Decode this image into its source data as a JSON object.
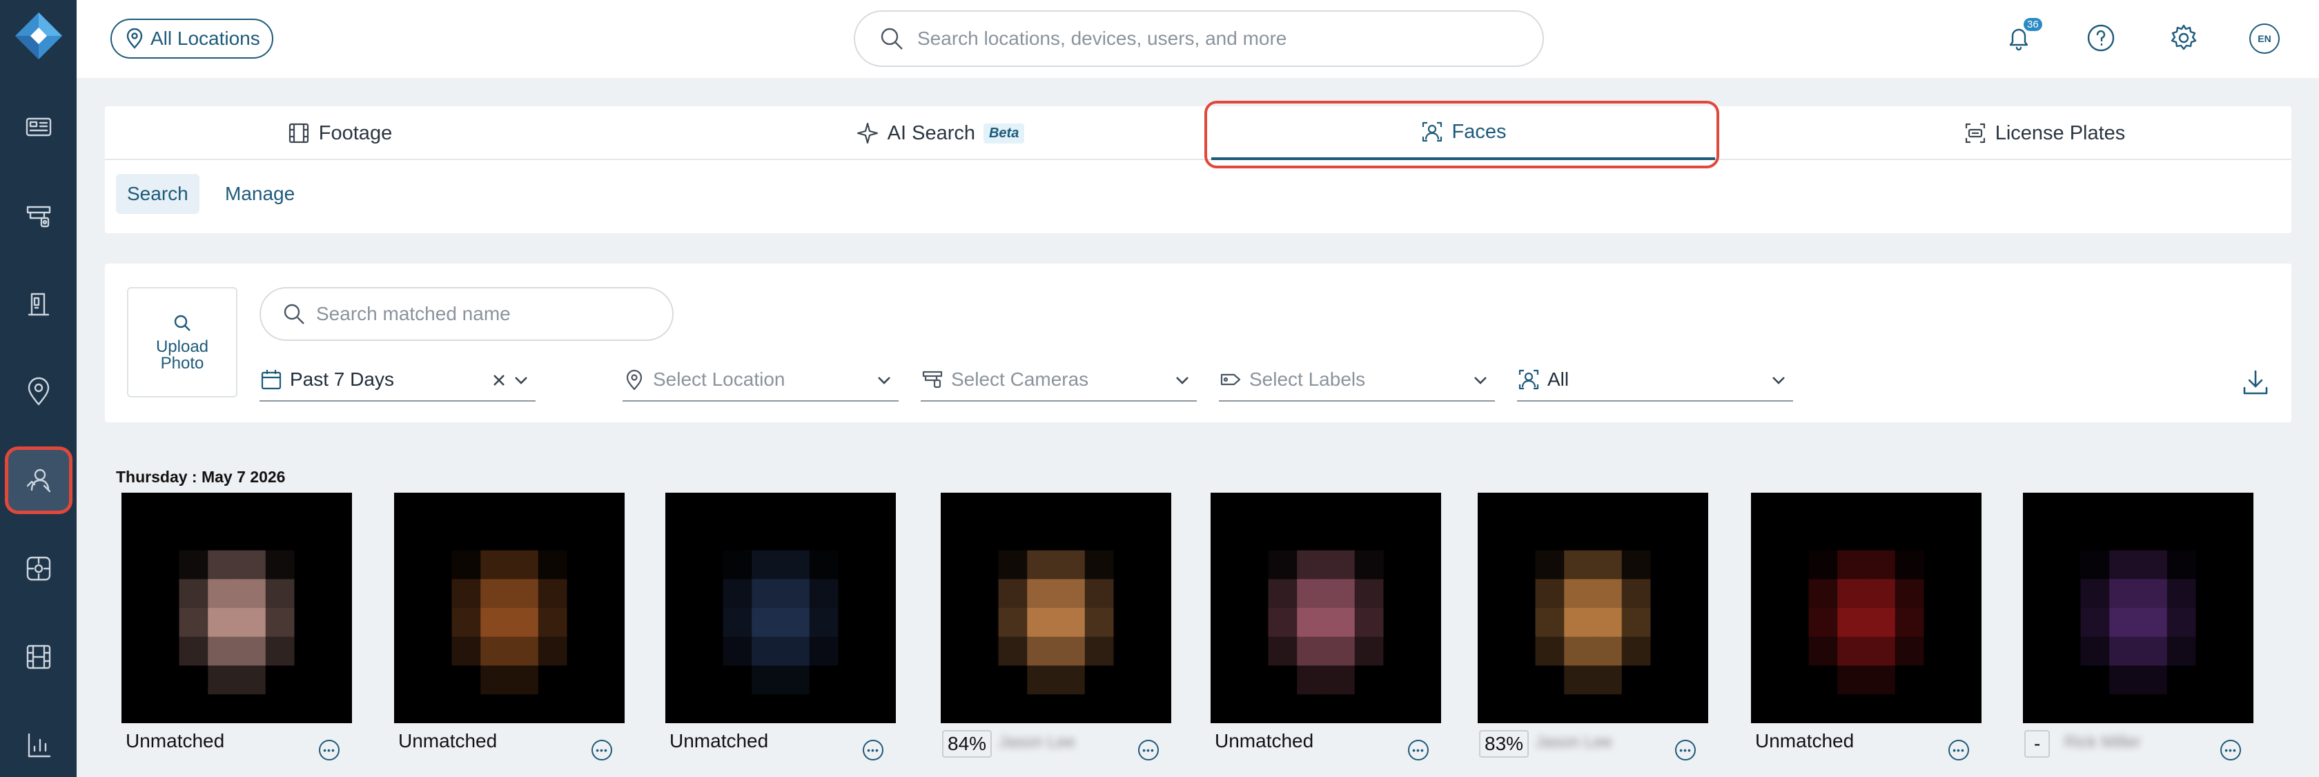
{
  "topbar": {
    "location_button": "All Locations",
    "search_placeholder": "Search locations, devices, users, and more",
    "notification_count": "36",
    "language": "EN"
  },
  "tabs": [
    {
      "label": "Footage",
      "icon": "film-icon"
    },
    {
      "label": "AI Search",
      "icon": "sparkle-icon",
      "badge": "Beta"
    },
    {
      "label": "Faces",
      "icon": "face-scan-icon",
      "active": true
    },
    {
      "label": "License Plates",
      "icon": "license-plate-icon"
    }
  ],
  "subtabs": [
    {
      "label": "Search",
      "active": true
    },
    {
      "label": "Manage"
    }
  ],
  "filters": {
    "upload_line1": "Upload",
    "upload_line2": "Photo",
    "name_placeholder": "Search matched name",
    "date_range": "Past 7 Days",
    "location_placeholder": "Select Location",
    "cameras_placeholder": "Select Cameras",
    "labels_placeholder": "Select Labels",
    "match_filter": "All"
  },
  "results": {
    "date_heading": "Thursday : May 7 2026",
    "cards": [
      {
        "status": "Unmatched",
        "palette": [
          "#9a9ca2",
          "#b48a82",
          "#8d8f96"
        ]
      },
      {
        "status": "Unmatched",
        "palette": [
          "#7e8481",
          "#8a4a1e",
          "#6f7474"
        ]
      },
      {
        "status": "Unmatched",
        "palette": [
          "#a7a7ab",
          "#1e2d4a",
          "#a08270"
        ]
      },
      {
        "score": "84%",
        "name": "Jason Lee",
        "palette": [
          "#8c9192",
          "#b47744",
          "#8b8f90"
        ]
      },
      {
        "status": "Unmatched",
        "palette": [
          "#d3c2c6",
          "#925262",
          "#b9b2b3"
        ]
      },
      {
        "score": "83%",
        "name": "Jason Lee",
        "palette": [
          "#8e9488",
          "#b3773e",
          "#8d9188"
        ]
      },
      {
        "status": "Unmatched",
        "palette": [
          "#e8dde1",
          "#7c1214",
          "#c7b7bc"
        ]
      },
      {
        "score": "-",
        "name": "Rick Miller",
        "palette": [
          "#c5b3bf",
          "#45225c",
          "#a88e9a"
        ]
      }
    ]
  }
}
